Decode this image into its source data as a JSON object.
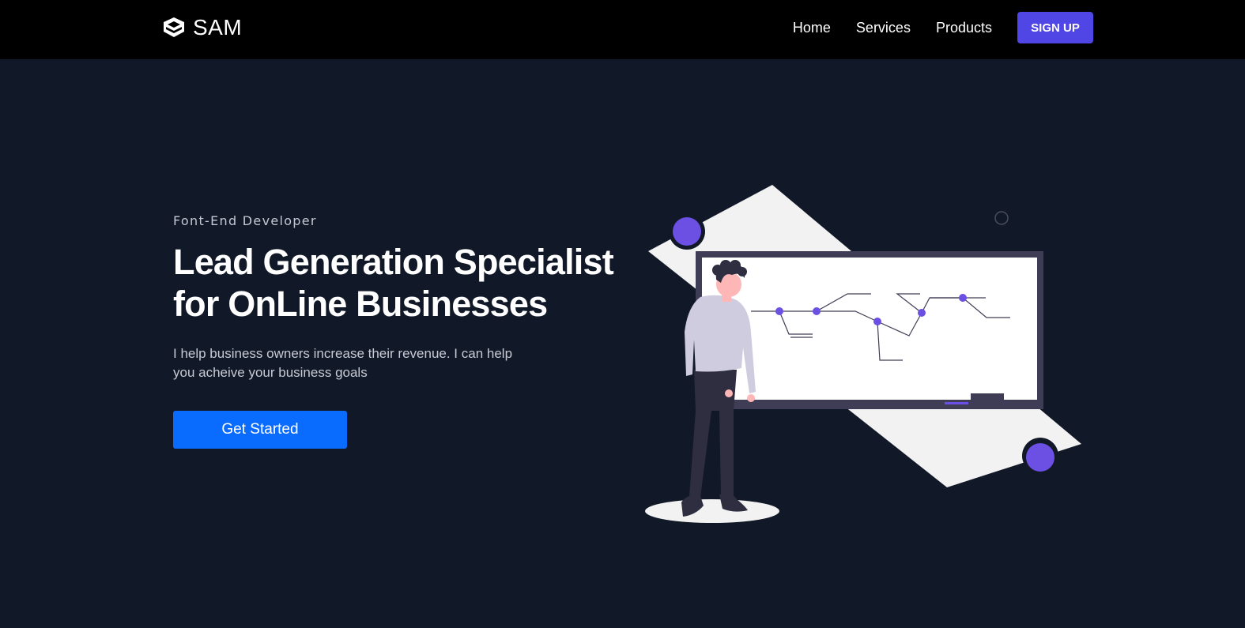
{
  "nav": {
    "brand": "SAM",
    "brand_icon": "cube-logo-icon",
    "links": [
      "Home",
      "Services",
      "Products"
    ],
    "signup_label": "SIGN UP"
  },
  "hero": {
    "eyebrow": "Font-End Developer",
    "headline_line1": "Lead Generation Specialist",
    "headline_line2": "for OnLine Businesses",
    "subtext": "I help business owners increase their revenue. I can help you acheive your business goals",
    "cta_label": "Get Started",
    "illustration": "person-presenting-whiteboard-illustration"
  },
  "colors": {
    "nav_bg": "#000000",
    "page_bg": "#111827",
    "signup_button": "#5046e5",
    "cta_button": "#0a6cff",
    "accent_purple": "#6c4fe3"
  }
}
